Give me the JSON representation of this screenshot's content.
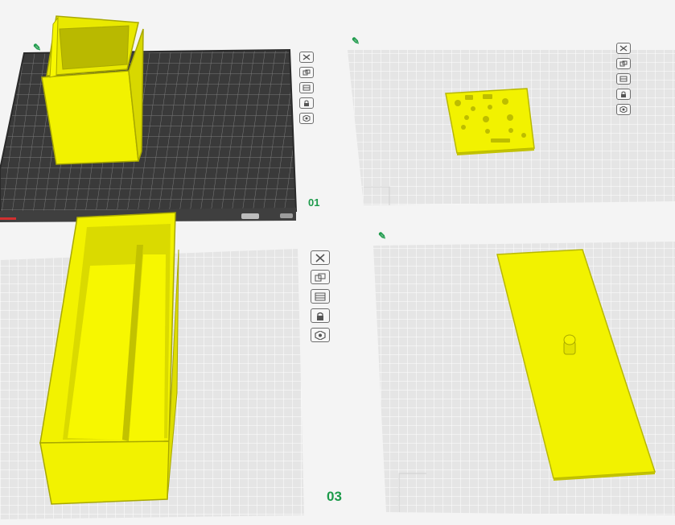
{
  "plates": [
    {
      "id": "plate-1",
      "label": "01",
      "object": "box-shell",
      "edit_icon": "pencil-icon"
    },
    {
      "id": "plate-2",
      "label": "",
      "object": "perforated-panel",
      "edit_icon": "pencil-icon"
    },
    {
      "id": "plate-3",
      "label": "03",
      "object": "long-tray",
      "edit_icon": "pencil-icon"
    },
    {
      "id": "plate-4",
      "label": "",
      "object": "flat-strip-with-peg",
      "edit_icon": "pencil-icon"
    }
  ],
  "plate_toolbar_icons": [
    "close-icon",
    "auto-arrange-icon",
    "plate-settings-icon",
    "lock-icon",
    "gear-icon"
  ],
  "edit_glyph": "✎",
  "colors": {
    "model": "#f2f200",
    "model_edge": "#a8a800",
    "plate_grid": "#e3e3e3",
    "active_plate": "#3c3c3c",
    "label": "#1c9a4a",
    "background": "#f4f4f4"
  }
}
